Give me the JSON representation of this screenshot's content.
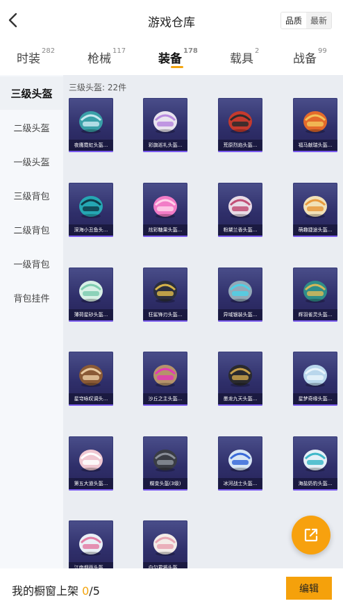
{
  "header": {
    "title": "游戏仓库",
    "sort_quality": "品质",
    "sort_newest": "最新"
  },
  "tabs": [
    {
      "label": "时装",
      "count": "282"
    },
    {
      "label": "枪械",
      "count": "117"
    },
    {
      "label": "装备",
      "count": "178"
    },
    {
      "label": "载具",
      "count": "2"
    },
    {
      "label": "战备",
      "count": "99"
    }
  ],
  "sidebar": {
    "items": [
      {
        "label": "三级头盔"
      },
      {
        "label": "二级头盔"
      },
      {
        "label": "一级头盔"
      },
      {
        "label": "三级背包"
      },
      {
        "label": "二级背包"
      },
      {
        "label": "一级背包"
      },
      {
        "label": "背包挂件"
      }
    ]
  },
  "content": {
    "count_label": "三级头盔: 22件",
    "items": [
      {
        "name": "夜鹰霓虹头盔...",
        "color": "#3aa0a8",
        "accent": "#c7e8f0"
      },
      {
        "name": "彩旗巡礼头盔...",
        "color": "#e9e4ef",
        "accent": "#b88adf"
      },
      {
        "name": "荒原烈焰头盔...",
        "color": "#c43a2e",
        "accent": "#2b2b2b"
      },
      {
        "name": "福马献瑞头盔...",
        "color": "#e46a2b",
        "accent": "#f2c25a"
      },
      {
        "name": "深海小丑鱼头...",
        "color": "#25a7b3",
        "accent": "#0f3c4a"
      },
      {
        "name": "炫彩糖果头盔...",
        "color": "#f27cc7",
        "accent": "#ffd1ea"
      },
      {
        "name": "粉黛兰香头盔...",
        "color": "#e8dbe6",
        "accent": "#c24f76"
      },
      {
        "name": "萌趣捷途头盔...",
        "color": "#f1e1b8",
        "accent": "#e89a3e"
      },
      {
        "name": "薄荷星砂头盔...",
        "color": "#d8f0e6",
        "accent": "#7fcdb0"
      },
      {
        "name": "狂鲨锋刃头盔...",
        "color": "#2c2f3e",
        "accent": "#d6b34a"
      },
      {
        "name": "异域银装头盔...",
        "color": "#93a9b8",
        "accent": "#4fd0e5"
      },
      {
        "name": "辉羽雀灵头盔...",
        "color": "#2f8e89",
        "accent": "#d3b85a"
      },
      {
        "name": "星穹咏叹调头...",
        "color": "#8a5a36",
        "accent": "#e8c9a0"
      },
      {
        "name": "沙丘之主头盔...",
        "color": "#b5936b",
        "accent": "#e23bb4"
      },
      {
        "name": "墨龙九天头盔...",
        "color": "#2a2a2e",
        "accent": "#c7a04a"
      },
      {
        "name": "星梦奇缘头盔...",
        "color": "#b9d7ec",
        "accent": "#e8f4fb"
      },
      {
        "name": "第五大道头盔...",
        "color": "#f0c8d2",
        "accent": "#ffffff"
      },
      {
        "name": "蝶变头盔(3级)",
        "color": "#3a3d45",
        "accent": "#8a8f99"
      },
      {
        "name": "冰河战士头盔...",
        "color": "#d7e6f5",
        "accent": "#3a6bd9"
      },
      {
        "name": "海盐奶豹头盔...",
        "color": "#e5f0f7",
        "accent": "#3fb8c9"
      },
      {
        "name": "江南烟雨头盔...",
        "color": "#eaf0f6",
        "accent": "#e37fa6"
      },
      {
        "name": "白勺君将头盔...",
        "color": "#f3ece8",
        "accent": "#e7a6b3"
      }
    ]
  },
  "bottom": {
    "showcase_label": "我的橱窗上架",
    "showcase_current": "0",
    "showcase_total": "/5",
    "edit_label": "编辑"
  },
  "icons": {
    "back": "chevron-left-icon",
    "share": "external-link-icon"
  },
  "colors": {
    "accent": "#f5a10b",
    "card_bg": "#2f2f6a"
  }
}
